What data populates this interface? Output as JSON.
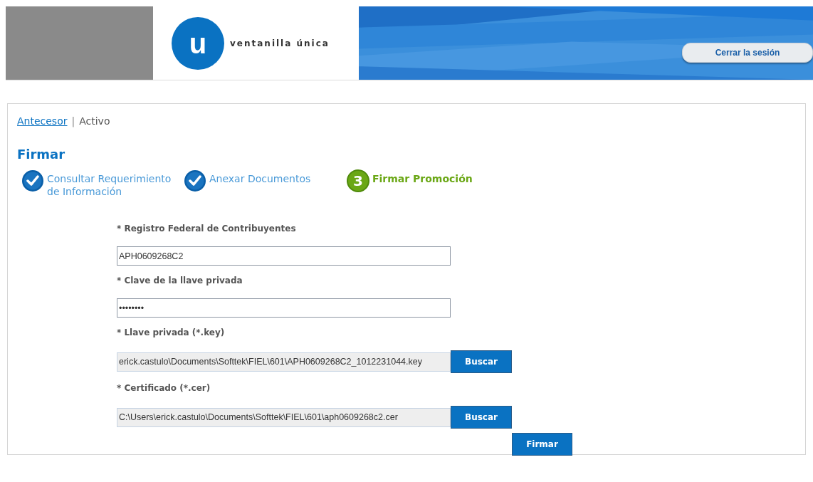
{
  "header": {
    "logo_letter": "u",
    "logo_text": "ventanilla única",
    "logout_button": "Cerrar la sesión"
  },
  "breadcrumb": [
    {
      "label": "Antecesor",
      "kind": "link"
    },
    {
      "label": "|",
      "kind": "separator"
    },
    {
      "label": "Activo",
      "kind": "current"
    }
  ],
  "title": "Firmar",
  "steps": [
    {
      "label": "Consultar Requerimiento de Información",
      "kind": "done"
    },
    {
      "label": "Anexar Documentos",
      "kind": "done"
    },
    {
      "label": "Firmar Promoción",
      "kind": "current",
      "number": "3"
    }
  ],
  "fields": [
    {
      "label": "* Registro Federal de Contribuyentes",
      "kind": "text",
      "value": "APH0609268C2"
    },
    {
      "label": "* Clave de la llave privada",
      "kind": "text",
      "value": "••••••••"
    },
    {
      "label": "* Llave privada (*.key)",
      "kind": "file",
      "value": "erick.castulo\\Documents\\Softtek\\FIEL\\601\\APH0609268C2_1012231044.key",
      "button": "Buscar"
    },
    {
      "label": "* Certificado (*.cer)",
      "kind": "file",
      "value": "C:\\Users\\erick.castulo\\Documents\\Softtek\\FIEL\\601\\aph0609268c2.cer",
      "button": "Buscar"
    }
  ],
  "submit_button": "Firmar"
}
